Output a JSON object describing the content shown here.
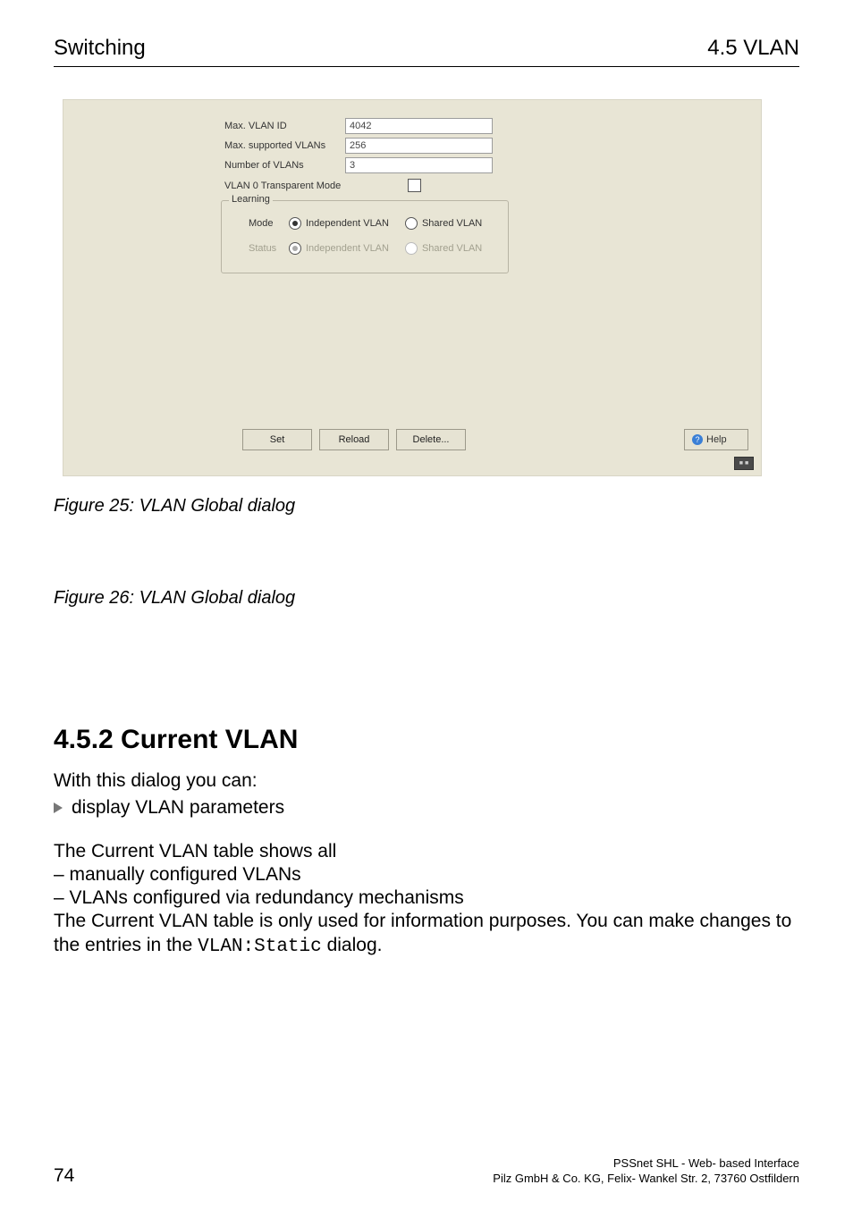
{
  "header": {
    "left": "Switching",
    "right": "4.5 VLAN"
  },
  "screenshot": {
    "fields": {
      "max_vlan_id": {
        "label": "Max. VLAN ID",
        "value": "4042"
      },
      "max_supported_vlans": {
        "label": "Max. supported VLANs",
        "value": "256"
      },
      "number_of_vlans": {
        "label": "Number of VLANs",
        "value": "3"
      },
      "vlan0_transparent_mode": {
        "label": "VLAN 0 Transparent Mode"
      }
    },
    "learning": {
      "group_title": "Learning",
      "mode_label": "Mode",
      "status_label": "Status",
      "opt_independent": "Independent VLAN",
      "opt_shared": "Shared VLAN"
    },
    "buttons": {
      "set": "Set",
      "reload": "Reload",
      "delete": "Delete..."
    },
    "help": "Help"
  },
  "captions": {
    "fig25": "Figure 25: VLAN Global dialog",
    "fig26": "Figure 26: VLAN Global dialog"
  },
  "section": {
    "heading": "4.5.2   Current VLAN",
    "intro": "With this dialog you can:",
    "bullet1": "display VLAN parameters",
    "para1": "The Current VLAN table shows all",
    "li1": "–   manually configured VLANs",
    "li2": "–   VLANs configured via redundancy mechanisms",
    "para2a": "The Current VLAN table is only used for information purposes. You can make changes to the entries in the ",
    "code": "VLAN:Static",
    "para2b": " dialog."
  },
  "footer": {
    "page": "74",
    "right1": "PSSnet SHL - Web- based Interface",
    "right2": "Pilz GmbH & Co. KG, Felix- Wankel Str. 2, 73760 Ostfildern"
  }
}
